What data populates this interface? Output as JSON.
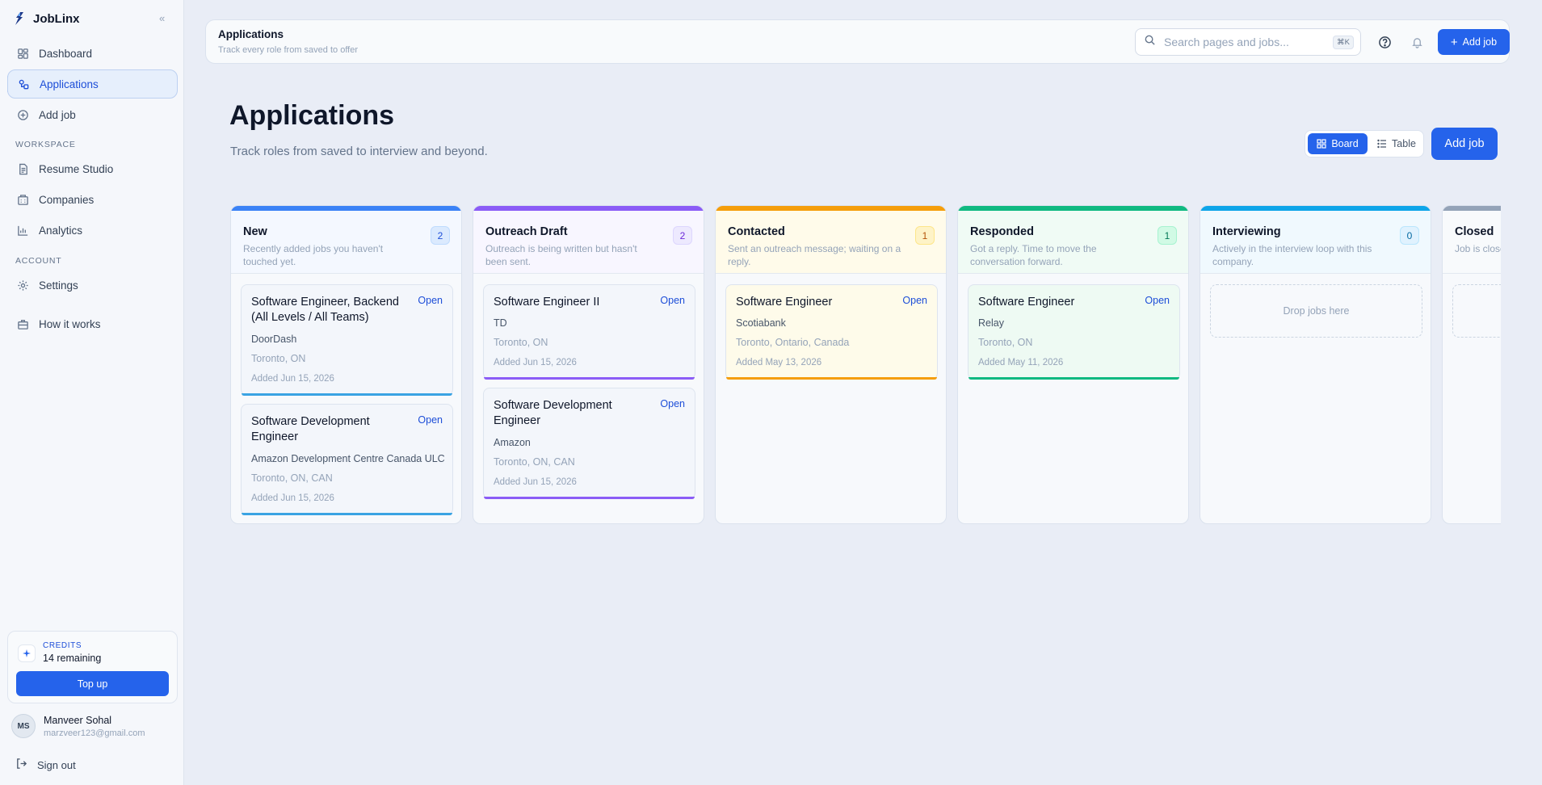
{
  "app": {
    "name": "JobLinx",
    "collapse_icon": "«"
  },
  "sidebar": {
    "nav": [
      {
        "label": "Dashboard",
        "icon": "grid-icon"
      },
      {
        "label": "Applications",
        "icon": "applications-icon",
        "active": true
      },
      {
        "label": "Add job",
        "icon": "plus-circle-icon"
      }
    ],
    "workspace_label": "WORKSPACE",
    "workspace": [
      {
        "label": "Resume Studio",
        "icon": "document-icon"
      },
      {
        "label": "Companies",
        "icon": "building-icon"
      },
      {
        "label": "Analytics",
        "icon": "bar-chart-icon"
      }
    ],
    "account_label": "ACCOUNT",
    "account": [
      {
        "label": "Settings",
        "icon": "gear-icon"
      },
      {
        "label": "How it works",
        "icon": "briefcase-icon"
      }
    ],
    "credits": {
      "label": "CREDITS",
      "remaining": "14 remaining",
      "topup_label": "Top up"
    },
    "user": {
      "initials": "MS",
      "name": "Manveer Sohal",
      "email": "marzveer123@gmail.com"
    },
    "signout_label": "Sign out"
  },
  "topbar": {
    "title": "Applications",
    "subtitle": "Track every role from saved to offer",
    "search_placeholder": "Search pages and jobs...",
    "search_shortcut": "⌘K",
    "add_job_label": "Add job"
  },
  "main": {
    "title": "Applications",
    "subtitle": "Track roles from saved to interview and beyond.",
    "view_board_label": "Board",
    "view_table_label": "Table",
    "add_job_label": "Add job"
  },
  "colors": {
    "accent": "#2563eb",
    "new": "#3b82f6",
    "outreach": "#8b5cf6",
    "contacted": "#f59e0b",
    "responded": "#10b981",
    "interviewing": "#0ea5e9",
    "closed": "#94a3b8"
  },
  "columns": [
    {
      "title": "New",
      "description": "Recently added jobs you haven't touched yet.",
      "count": "2",
      "color": "#3b82f6",
      "head_bg": "#f4f8ff",
      "badge_bg": "#dbeafe",
      "badge_border": "#bfdbfe",
      "badge_text": "#1d4ed8",
      "cards": [
        {
          "title": "Software Engineer, Backend (All Levels / All Teams)",
          "company": "DoorDash",
          "location": "Toronto, ON",
          "added": "Added Jun 15, 2026",
          "open": "Open",
          "lines": 2,
          "bottom": "#3aa3e3"
        },
        {
          "title": "Software Development Engineer",
          "company": "Amazon Development Centre Canada ULC",
          "location": "Toronto, ON, CAN",
          "added": "Added Jun 15, 2026",
          "open": "Open",
          "lines": 2,
          "bottom": "#3aa3e3"
        }
      ]
    },
    {
      "title": "Outreach Draft",
      "description": "Outreach is being written but hasn't been sent.",
      "count": "2",
      "color": "#8b5cf6",
      "head_bg": "#f8f6ff",
      "badge_bg": "#ede9fe",
      "badge_border": "#ddd6fe",
      "badge_text": "#6d28d9",
      "cards": [
        {
          "title": "Software Engineer II",
          "company": "TD",
          "location": "Toronto, ON",
          "added": "Added Jun 15, 2026",
          "open": "Open",
          "lines": 1,
          "bottom": "#8b5cf6"
        },
        {
          "title": "Software Development Engineer",
          "company": "Amazon",
          "location": "Toronto, ON, CAN",
          "added": "Added Jun 15, 2026",
          "open": "Open",
          "lines": 2,
          "bottom": "#8b5cf6"
        }
      ]
    },
    {
      "title": "Contacted",
      "description": "Sent an outreach message; waiting on a reply.",
      "count": "1",
      "color": "#f59e0b",
      "head_bg": "#fffbea",
      "badge_bg": "#fef3c7",
      "badge_border": "#fde68a",
      "badge_text": "#b45309",
      "cards": [
        {
          "title": "Software Engineer",
          "company": "Scotiabank",
          "location": "Toronto, Ontario, Canada",
          "added": "Added May 13, 2026",
          "open": "Open",
          "lines": 1,
          "bottom": "#f59e0b",
          "card_bg": "#fefbea"
        }
      ]
    },
    {
      "title": "Responded",
      "description": "Got a reply. Time to move the conversation forward.",
      "count": "1",
      "color": "#10b981",
      "head_bg": "#f0fbf5",
      "badge_bg": "#d1fae5",
      "badge_border": "#a7f3d0",
      "badge_text": "#047857",
      "cards": [
        {
          "title": "Software Engineer",
          "company": "Relay",
          "location": "Toronto, ON",
          "added": "Added May 11, 2026",
          "open": "Open",
          "lines": 1,
          "bottom": "#10b981",
          "card_bg": "#eefaf3"
        }
      ]
    },
    {
      "title": "Interviewing",
      "description": "Actively in the interview loop with this company.",
      "count": "0",
      "color": "#0ea5e9",
      "head_bg": "#f0f9fe",
      "badge_bg": "#e0f2fe",
      "badge_border": "#bae6fd",
      "badge_text": "#0369a1",
      "dropzone": "Drop jobs here",
      "cards": []
    },
    {
      "title": "Closed",
      "description": "Job is closed or no longer pursued.",
      "count": "",
      "color": "#94a3b8",
      "head_bg": "#f8fafc",
      "badge_bg": "#f1f5f9",
      "badge_border": "#e2e8f0",
      "badge_text": "#475569",
      "dropzone": "",
      "cards": []
    }
  ]
}
